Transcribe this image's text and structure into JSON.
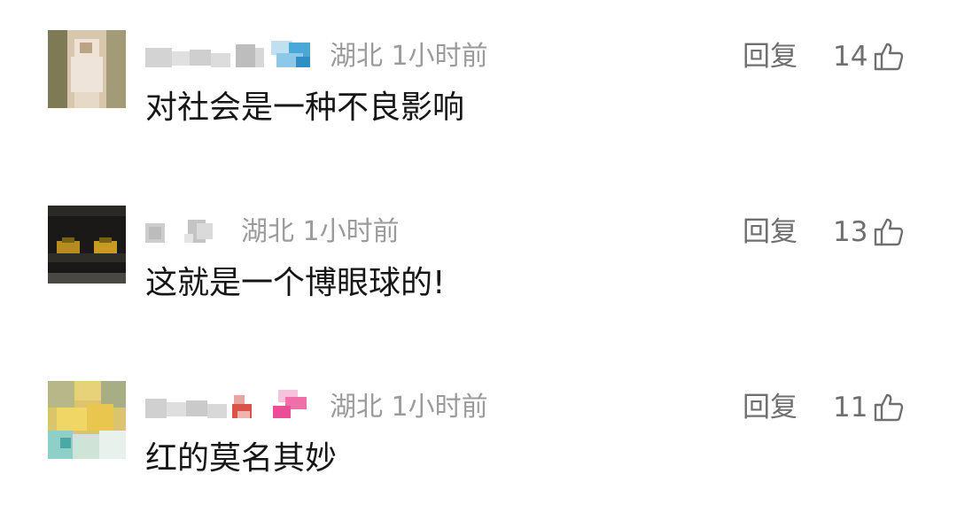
{
  "comments": [
    {
      "location": "湖北",
      "time": "1小时前",
      "text": "对社会是一种不良影响",
      "reply_label": "回复",
      "likes": "14",
      "avatar_icon": "avatar-photo-person",
      "avatar_colors": [
        "#8a8560",
        "#d9c9b0",
        "#efe6dc"
      ]
    },
    {
      "location": "湖北",
      "time": "1小时前",
      "text": "这就是一个博眼球的!",
      "reply_label": "回复",
      "likes": "13",
      "avatar_icon": "avatar-dark-eyes",
      "avatar_colors": [
        "#171614",
        "#c79a22"
      ]
    },
    {
      "location": "湖北",
      "time": "1小时前",
      "text": "红的莫名其妙",
      "reply_label": "回复",
      "likes": "11",
      "avatar_icon": "avatar-yellow-flowers",
      "avatar_colors": [
        "#e8cf6a",
        "#7cc6c2",
        "#a9b38a"
      ]
    }
  ],
  "colors": {
    "meta_text": "#9b9b9b",
    "action_text": "#6f6f6f",
    "body_text": "#161616",
    "background": "#ffffff"
  },
  "like_icon": "thumbs-up-icon"
}
